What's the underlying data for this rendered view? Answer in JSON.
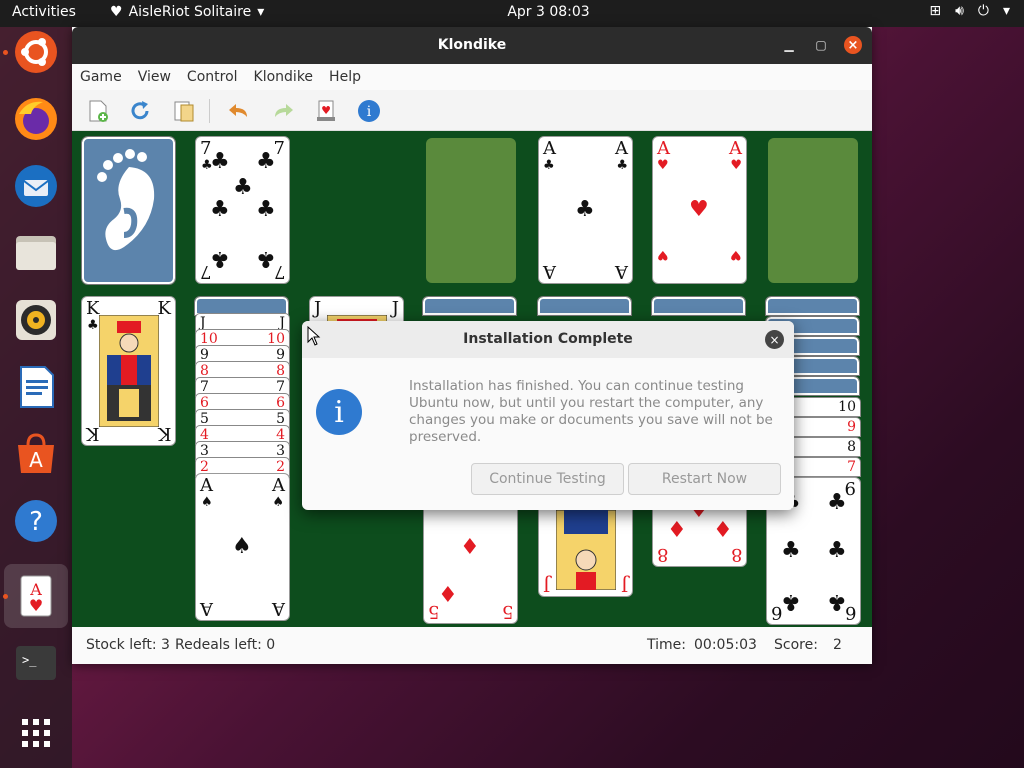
{
  "topbar": {
    "activities": "Activities",
    "app_name": "AisleRiot Solitaire",
    "clock": "Apr 3  08:03"
  },
  "dock": {
    "items": [
      "ubuntu-software-icon",
      "firefox-icon",
      "thunderbird-icon",
      "files-icon",
      "rhythmbox-icon",
      "writer-icon",
      "app-store-icon",
      "help-icon",
      "aisleriot-icon",
      "terminal-icon",
      "show-apps-icon"
    ]
  },
  "window": {
    "title": "Klondike",
    "menu": [
      "Game",
      "View",
      "Control",
      "Klondike",
      "Help"
    ],
    "toolbar": [
      "new-game-icon",
      "restart-icon",
      "select-game-icon",
      "undo-icon",
      "redo-icon",
      "hint-icon",
      "info-icon"
    ]
  },
  "board": {
    "foundations": [
      {
        "rank": "A",
        "suit": "♣",
        "color": "blk"
      },
      {
        "rank": "A",
        "suit": "♥",
        "color": "red"
      }
    ],
    "waste_card": {
      "rank": "7",
      "suit": "♣"
    },
    "tableau_1_top": {
      "rank": "K",
      "suit": "♣"
    },
    "tableau_2_strips": [
      "J",
      "10",
      "9",
      "8",
      "7",
      "6",
      "5",
      "4",
      "3",
      "2"
    ],
    "tableau_2_top": {
      "rank": "A",
      "suit": "♠"
    },
    "tableau_3_top": {
      "rank": "J",
      "suit": "♥"
    },
    "tableau_4_top": {
      "rank": "5",
      "suit": "♦"
    },
    "tableau_5_top": {
      "rank": "J",
      "suit": "♥"
    },
    "tableau_6_top": {
      "rank": "8",
      "suit": "♦"
    },
    "tableau_7_strips": [
      "10",
      "9",
      "8",
      "7"
    ],
    "tableau_7_top": {
      "rank": "6",
      "suit": "♣"
    }
  },
  "status": {
    "stock": "Stock left: 3",
    "redeals": "Redeals left: 0",
    "time_label": "Time:",
    "time_value": "00:05:03",
    "score_label": "Score:",
    "score_value": "2"
  },
  "dialog": {
    "title": "Installation Complete",
    "message": "Installation has finished.  You can continue testing Ubuntu now, but until you restart the computer, any changes you make or documents you save will not be preserved.",
    "continue_label": "Continue Testing",
    "restart_label": "Restart Now"
  }
}
